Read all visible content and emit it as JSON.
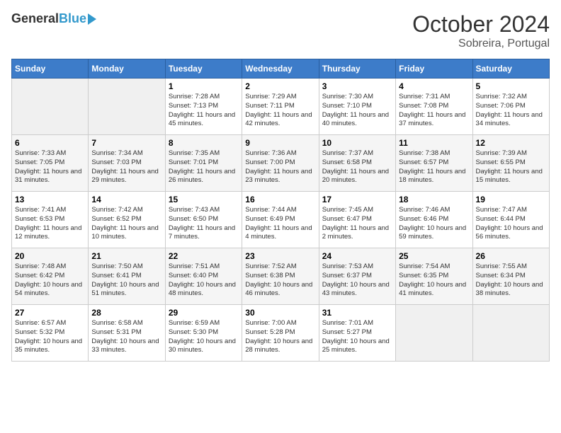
{
  "header": {
    "logo_general": "General",
    "logo_blue": "Blue",
    "title": "October 2024",
    "subtitle": "Sobreira, Portugal"
  },
  "days_of_week": [
    "Sunday",
    "Monday",
    "Tuesday",
    "Wednesday",
    "Thursday",
    "Friday",
    "Saturday"
  ],
  "weeks": [
    [
      {
        "day": "",
        "sunrise": "",
        "sunset": "",
        "daylight": ""
      },
      {
        "day": "",
        "sunrise": "",
        "sunset": "",
        "daylight": ""
      },
      {
        "day": "1",
        "sunrise": "Sunrise: 7:28 AM",
        "sunset": "Sunset: 7:13 PM",
        "daylight": "Daylight: 11 hours and 45 minutes."
      },
      {
        "day": "2",
        "sunrise": "Sunrise: 7:29 AM",
        "sunset": "Sunset: 7:11 PM",
        "daylight": "Daylight: 11 hours and 42 minutes."
      },
      {
        "day": "3",
        "sunrise": "Sunrise: 7:30 AM",
        "sunset": "Sunset: 7:10 PM",
        "daylight": "Daylight: 11 hours and 40 minutes."
      },
      {
        "day": "4",
        "sunrise": "Sunrise: 7:31 AM",
        "sunset": "Sunset: 7:08 PM",
        "daylight": "Daylight: 11 hours and 37 minutes."
      },
      {
        "day": "5",
        "sunrise": "Sunrise: 7:32 AM",
        "sunset": "Sunset: 7:06 PM",
        "daylight": "Daylight: 11 hours and 34 minutes."
      }
    ],
    [
      {
        "day": "6",
        "sunrise": "Sunrise: 7:33 AM",
        "sunset": "Sunset: 7:05 PM",
        "daylight": "Daylight: 11 hours and 31 minutes."
      },
      {
        "day": "7",
        "sunrise": "Sunrise: 7:34 AM",
        "sunset": "Sunset: 7:03 PM",
        "daylight": "Daylight: 11 hours and 29 minutes."
      },
      {
        "day": "8",
        "sunrise": "Sunrise: 7:35 AM",
        "sunset": "Sunset: 7:01 PM",
        "daylight": "Daylight: 11 hours and 26 minutes."
      },
      {
        "day": "9",
        "sunrise": "Sunrise: 7:36 AM",
        "sunset": "Sunset: 7:00 PM",
        "daylight": "Daylight: 11 hours and 23 minutes."
      },
      {
        "day": "10",
        "sunrise": "Sunrise: 7:37 AM",
        "sunset": "Sunset: 6:58 PM",
        "daylight": "Daylight: 11 hours and 20 minutes."
      },
      {
        "day": "11",
        "sunrise": "Sunrise: 7:38 AM",
        "sunset": "Sunset: 6:57 PM",
        "daylight": "Daylight: 11 hours and 18 minutes."
      },
      {
        "day": "12",
        "sunrise": "Sunrise: 7:39 AM",
        "sunset": "Sunset: 6:55 PM",
        "daylight": "Daylight: 11 hours and 15 minutes."
      }
    ],
    [
      {
        "day": "13",
        "sunrise": "Sunrise: 7:41 AM",
        "sunset": "Sunset: 6:53 PM",
        "daylight": "Daylight: 11 hours and 12 minutes."
      },
      {
        "day": "14",
        "sunrise": "Sunrise: 7:42 AM",
        "sunset": "Sunset: 6:52 PM",
        "daylight": "Daylight: 11 hours and 10 minutes."
      },
      {
        "day": "15",
        "sunrise": "Sunrise: 7:43 AM",
        "sunset": "Sunset: 6:50 PM",
        "daylight": "Daylight: 11 hours and 7 minutes."
      },
      {
        "day": "16",
        "sunrise": "Sunrise: 7:44 AM",
        "sunset": "Sunset: 6:49 PM",
        "daylight": "Daylight: 11 hours and 4 minutes."
      },
      {
        "day": "17",
        "sunrise": "Sunrise: 7:45 AM",
        "sunset": "Sunset: 6:47 PM",
        "daylight": "Daylight: 11 hours and 2 minutes."
      },
      {
        "day": "18",
        "sunrise": "Sunrise: 7:46 AM",
        "sunset": "Sunset: 6:46 PM",
        "daylight": "Daylight: 10 hours and 59 minutes."
      },
      {
        "day": "19",
        "sunrise": "Sunrise: 7:47 AM",
        "sunset": "Sunset: 6:44 PM",
        "daylight": "Daylight: 10 hours and 56 minutes."
      }
    ],
    [
      {
        "day": "20",
        "sunrise": "Sunrise: 7:48 AM",
        "sunset": "Sunset: 6:42 PM",
        "daylight": "Daylight: 10 hours and 54 minutes."
      },
      {
        "day": "21",
        "sunrise": "Sunrise: 7:50 AM",
        "sunset": "Sunset: 6:41 PM",
        "daylight": "Daylight: 10 hours and 51 minutes."
      },
      {
        "day": "22",
        "sunrise": "Sunrise: 7:51 AM",
        "sunset": "Sunset: 6:40 PM",
        "daylight": "Daylight: 10 hours and 48 minutes."
      },
      {
        "day": "23",
        "sunrise": "Sunrise: 7:52 AM",
        "sunset": "Sunset: 6:38 PM",
        "daylight": "Daylight: 10 hours and 46 minutes."
      },
      {
        "day": "24",
        "sunrise": "Sunrise: 7:53 AM",
        "sunset": "Sunset: 6:37 PM",
        "daylight": "Daylight: 10 hours and 43 minutes."
      },
      {
        "day": "25",
        "sunrise": "Sunrise: 7:54 AM",
        "sunset": "Sunset: 6:35 PM",
        "daylight": "Daylight: 10 hours and 41 minutes."
      },
      {
        "day": "26",
        "sunrise": "Sunrise: 7:55 AM",
        "sunset": "Sunset: 6:34 PM",
        "daylight": "Daylight: 10 hours and 38 minutes."
      }
    ],
    [
      {
        "day": "27",
        "sunrise": "Sunrise: 6:57 AM",
        "sunset": "Sunset: 5:32 PM",
        "daylight": "Daylight: 10 hours and 35 minutes."
      },
      {
        "day": "28",
        "sunrise": "Sunrise: 6:58 AM",
        "sunset": "Sunset: 5:31 PM",
        "daylight": "Daylight: 10 hours and 33 minutes."
      },
      {
        "day": "29",
        "sunrise": "Sunrise: 6:59 AM",
        "sunset": "Sunset: 5:30 PM",
        "daylight": "Daylight: 10 hours and 30 minutes."
      },
      {
        "day": "30",
        "sunrise": "Sunrise: 7:00 AM",
        "sunset": "Sunset: 5:28 PM",
        "daylight": "Daylight: 10 hours and 28 minutes."
      },
      {
        "day": "31",
        "sunrise": "Sunrise: 7:01 AM",
        "sunset": "Sunset: 5:27 PM",
        "daylight": "Daylight: 10 hours and 25 minutes."
      },
      {
        "day": "",
        "sunrise": "",
        "sunset": "",
        "daylight": ""
      },
      {
        "day": "",
        "sunrise": "",
        "sunset": "",
        "daylight": ""
      }
    ]
  ]
}
